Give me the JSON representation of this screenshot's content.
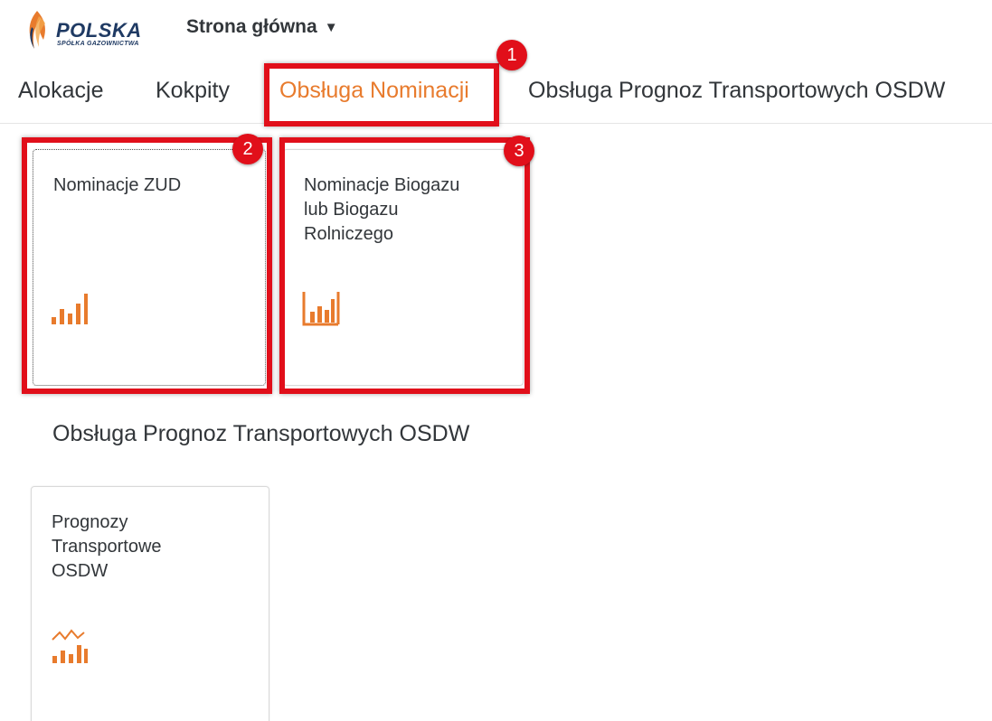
{
  "header": {
    "logo_text": "POLSKA",
    "logo_subtext": "SPÓŁKA GAZOWNICTWA",
    "home_label": "Strona główna",
    "home_caret": "▼"
  },
  "tabs": [
    {
      "label": "Alokacje",
      "active": false
    },
    {
      "label": "Kokpity",
      "active": false
    },
    {
      "label": "Obsługa Nominacji",
      "active": true
    },
    {
      "label": "Obsługa Prognoz Transportowych OSDW",
      "active": false
    }
  ],
  "tiles": [
    {
      "title": "Nominacje ZUD",
      "icon": "bar-chart-icon"
    },
    {
      "title": "Nominacje Biogazu\nlub Biogazu\nRolniczego",
      "icon": "framed-bar-chart-icon"
    },
    {
      "title": "Prognozy\nTransportowe\nOSDW",
      "icon": "trend-bar-chart-icon"
    }
  ],
  "section": {
    "title": "Obsługa Prognoz Transportowych OSDW"
  },
  "badges": [
    "1",
    "2",
    "3"
  ],
  "colors": {
    "accent": "#e87b2d",
    "highlight": "#e10f1a",
    "logo_blue": "#1f3a63"
  }
}
